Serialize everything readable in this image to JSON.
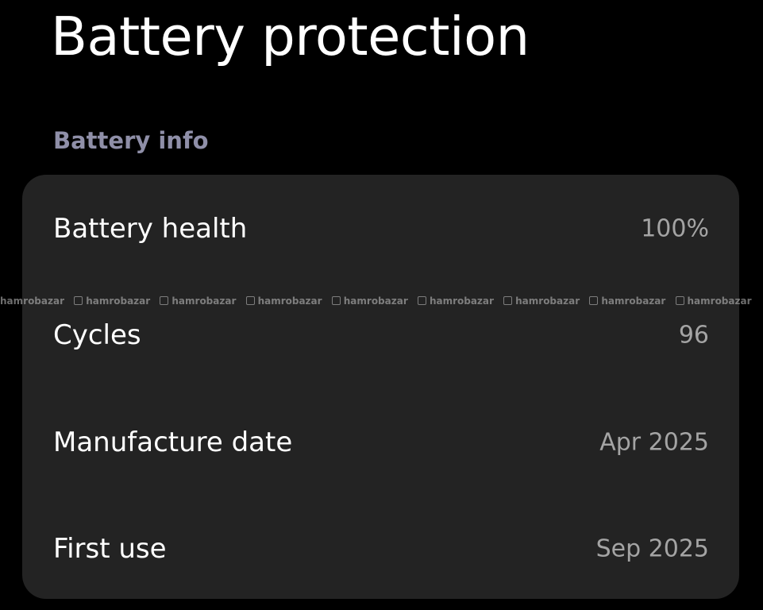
{
  "header": {
    "title": "Battery protection"
  },
  "section": {
    "title": "Battery info"
  },
  "battery_info": {
    "rows": [
      {
        "label": "Battery health",
        "value": "100%"
      },
      {
        "label": "Cycles",
        "value": "96"
      },
      {
        "label": "Manufacture date",
        "value": "Apr 2025"
      },
      {
        "label": "First use",
        "value": "Sep 2025"
      }
    ]
  },
  "watermark": {
    "text": "hamrobazar"
  },
  "colors": {
    "background": "#000000",
    "card": "#232323",
    "section_header": "#8f8fa8",
    "value_text": "#a4a4a4"
  }
}
